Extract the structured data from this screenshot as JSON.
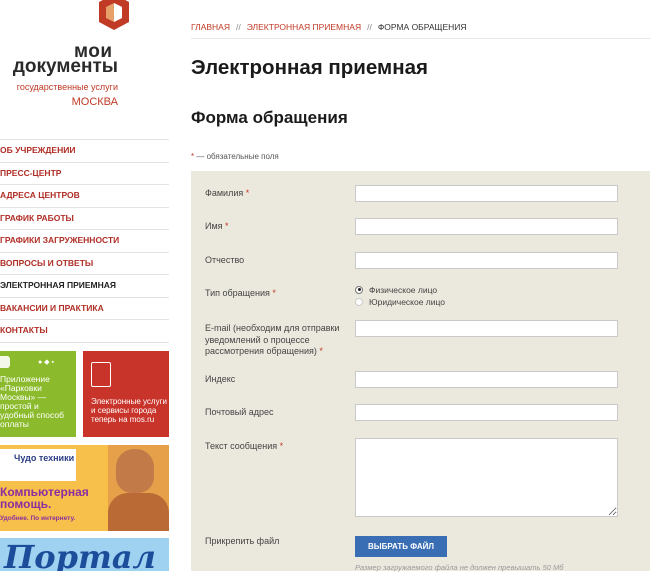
{
  "logo": {
    "line1": "мои",
    "line2": "документы",
    "line3": "государственные услуги",
    "line4": "МОСКВА"
  },
  "menu": [
    {
      "label": "ОБ УЧРЕЖДЕНИИ",
      "active": false
    },
    {
      "label": "ПРЕСС-ЦЕНТР",
      "active": false
    },
    {
      "label": "АДРЕСА ЦЕНТРОВ",
      "active": false
    },
    {
      "label": "ГРАФИК РАБОТЫ",
      "active": false
    },
    {
      "label": "ГРАФИКИ ЗАГРУЖЕННОСТИ",
      "active": false
    },
    {
      "label": "ВОПРОСЫ И ОТВЕТЫ",
      "active": false
    },
    {
      "label": "ЭЛЕКТРОННАЯ ПРИЕМНАЯ",
      "active": true
    },
    {
      "label": "ВАКАНСИИ И ПРАКТИКА",
      "active": false
    },
    {
      "label": "КОНТАКТЫ",
      "active": false
    }
  ],
  "banners": {
    "parking": {
      "text": "Приложение «Парковки Москвы» — простой и удобный способ оплаты"
    },
    "mos": {
      "text": "Электронные услуги и сервисы города теперь на mos.ru"
    },
    "tech": {
      "logo": "Чудо техники",
      "line1": "Компьютерная помощь.",
      "line2": "Удобнее. По интернету."
    },
    "portal": {
      "text": "Портал"
    }
  },
  "breadcrumb": {
    "home": "ГЛАВНАЯ",
    "parent": "ЭЛЕКТРОННАЯ ПРИЕМНАЯ",
    "current": "ФОРМА ОБРАЩЕНИЯ",
    "separator": "//"
  },
  "page_title": "Электронная приемная",
  "form_title": "Форма обращения",
  "required_note": {
    "star": "*",
    "text": " — обязательные поля"
  },
  "fields": {
    "surname": {
      "label": "Фамилия",
      "required": "*",
      "value": ""
    },
    "name": {
      "label": "Имя",
      "required": "*",
      "value": ""
    },
    "patronymic": {
      "label": "Отчество",
      "value": ""
    },
    "type": {
      "label": "Тип обращения",
      "required": "*",
      "options": [
        "Физическое лицо",
        "Юридическое лицо"
      ],
      "selected": "Физическое лицо"
    },
    "email": {
      "label": "E-mail (необходим для отправки уведомлений о процессе рассмотрения обращения)",
      "required": "*",
      "value": ""
    },
    "index": {
      "label": "Индекс",
      "value": ""
    },
    "address": {
      "label": "Почтовый адрес",
      "value": ""
    },
    "message": {
      "label": "Текст сообщения",
      "required": "*",
      "value": ""
    },
    "file": {
      "label": "Прикрепить файл",
      "button": "ВЫБРАТЬ ФАЙЛ",
      "note": "Размер загружаемого файла не должен превышать 50 Мб"
    }
  },
  "colors": {
    "accent": "#c03a26",
    "form_bg": "#ebe8de",
    "button": "#3a6eb4"
  }
}
